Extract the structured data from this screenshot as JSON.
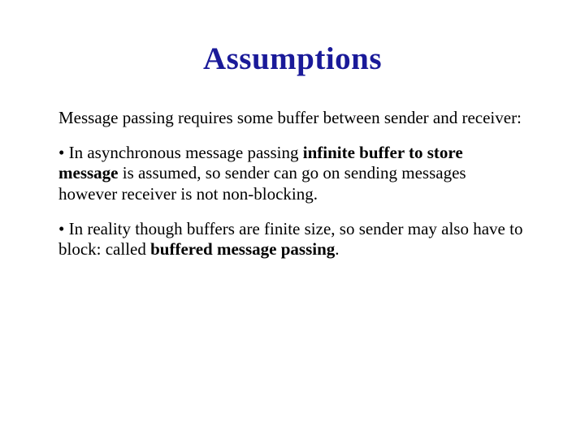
{
  "title": "Assumptions",
  "intro": "Message passing requires some buffer between sender and receiver:",
  "bullets": [
    {
      "glyph": "• ",
      "p0": "In asynchronous message passing ",
      "b0": "infinite buffer to store message",
      "p1": " is assumed, so sender can go on sending messages however receiver is not non-blocking."
    },
    {
      "glyph": "• ",
      "p0": "In reality though buffers are finite size, so sender may also have to block: called ",
      "b0": "buffered message passing",
      "p1": "."
    }
  ]
}
